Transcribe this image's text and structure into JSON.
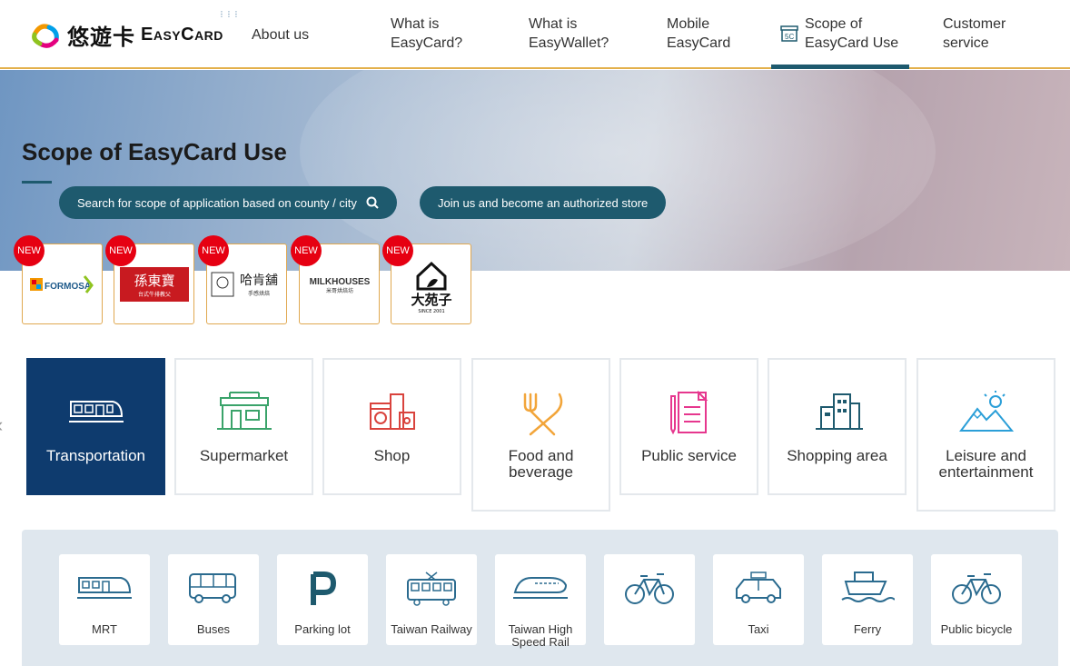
{
  "header": {
    "logo": {
      "zh": "悠遊卡",
      "en": "EasyCard"
    },
    "nav": [
      {
        "label": "About us"
      },
      {
        "label_line1": "What is",
        "label_line2": "EasyCard?"
      },
      {
        "label_line1": "What is",
        "label_line2": "EasyWallet?"
      },
      {
        "label_line1": "Mobile",
        "label_line2": "EasyCard"
      },
      {
        "label_line1": "Scope of",
        "label_line2": "EasyCard Use"
      },
      {
        "label_line1": "Customer",
        "label_line2": "service"
      }
    ]
  },
  "hero": {
    "title": "Scope of EasyCard Use",
    "search_button": "Search for scope of application based on county / city",
    "join_button": "Join us and become an authorized store"
  },
  "brands": [
    {
      "badge": "NEW",
      "logo_text": "FORMOSA"
    },
    {
      "badge": "NEW",
      "logo_text": "孫東寶",
      "logo_sub": "台式牛排教父"
    },
    {
      "badge": "NEW",
      "logo_text": "哈肯舖",
      "logo_sub": "手感烘焙"
    },
    {
      "badge": "NEW",
      "logo_text": "MILKHOUSES",
      "logo_sub": "米哥烘焙坊"
    },
    {
      "badge": "NEW",
      "logo_text": "大苑子",
      "logo_sub": "SINCE 2001"
    }
  ],
  "categories": [
    {
      "label": "Transportation",
      "icon": "train-icon",
      "active": true
    },
    {
      "label": "Supermarket",
      "icon": "store-icon",
      "active": false
    },
    {
      "label": "Shop",
      "icon": "appliance-icon",
      "active": false
    },
    {
      "label_line1": "Food and",
      "label_line2": "beverage",
      "icon": "fork-knife-icon",
      "active": false
    },
    {
      "label": "Public service",
      "icon": "document-icon",
      "active": false
    },
    {
      "label": "Shopping area",
      "icon": "building-icon",
      "active": false
    },
    {
      "label_line1": "Leisure and",
      "label_line2": "entertainment",
      "icon": "mountain-icon",
      "active": false
    }
  ],
  "subcategories": [
    {
      "label": "MRT",
      "icon": "mrt-icon"
    },
    {
      "label": "Buses",
      "icon": "bus-icon"
    },
    {
      "label": "Parking lot",
      "icon": "parking-icon"
    },
    {
      "label": "Taiwan Railway",
      "icon": "tram-icon"
    },
    {
      "label_line1": "Taiwan High",
      "label_line2": "Speed Rail",
      "icon": "hsr-icon"
    },
    {
      "label": "",
      "icon": "bicycle-icon"
    },
    {
      "label": "Taxi",
      "icon": "taxi-icon"
    },
    {
      "label": "Ferry",
      "icon": "ferry-icon"
    },
    {
      "label": "Public bicycle",
      "icon": "public-bicycle-icon"
    }
  ],
  "colors": {
    "primary": "#1e5a6e",
    "active_tile": "#0e3b6e",
    "accent": "#e3b04b",
    "badge": "#e60012",
    "icon_blue": "#2b6b8f"
  }
}
